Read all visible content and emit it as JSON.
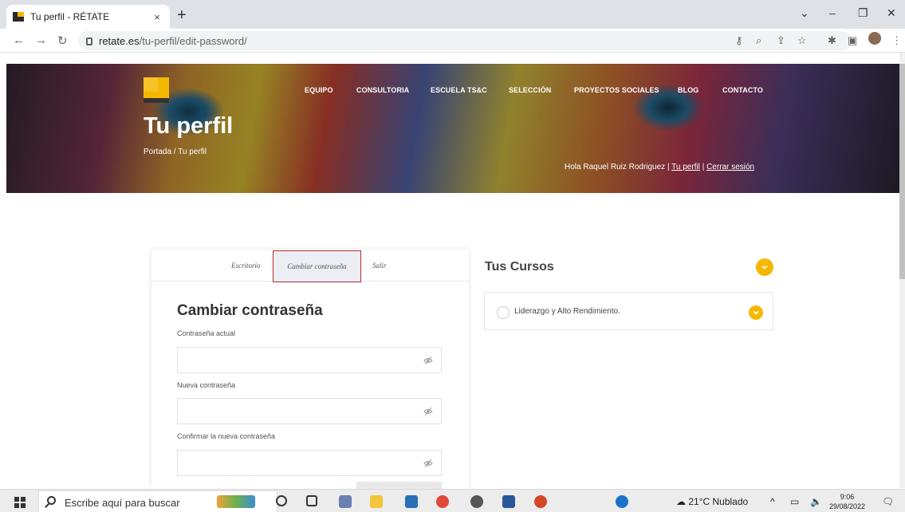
{
  "browser": {
    "tab_title": "Tu perfil - RÉTATE",
    "close_glyph": "×",
    "newtab_glyph": "+",
    "url_host": "retate.es",
    "url_path": "/tu-perfil/edit-password/"
  },
  "site": {
    "nav": [
      "EQUIPO",
      "CONSULTORIA",
      "ESCUELA TS&C",
      "SELECCIÓN",
      "PROYECTOS SOCIALES",
      "BLOG",
      "CONTACTO"
    ],
    "page_title": "Tu perfil",
    "breadcrumb": "Portada / Tu perfil",
    "greeting_prefix": "Hola Raquel Ruiz Rodriguez | ",
    "profile_link": "Tu perfil",
    "separator": " | ",
    "logout_link": "Cerrar sesión",
    "accent": "#f5b800"
  },
  "profile": {
    "tabs": [
      "Escritorio",
      "Cambiar contraseña",
      "Salir"
    ],
    "form_title": "Cambiar contraseña",
    "fields": [
      {
        "label": "Contraseña actual"
      },
      {
        "label": "Nueva contraseña"
      },
      {
        "label": "Confirmar la nueva contraseña"
      }
    ]
  },
  "courses": {
    "title": "Tus Cursos",
    "items": [
      "Liderazgo y Alto Rendimiento."
    ]
  },
  "taskbar": {
    "search_placeholder": "Escribe aquí para buscar",
    "weather": "21°C  Nublado",
    "time": "9:06",
    "date": "29/08/2022"
  }
}
